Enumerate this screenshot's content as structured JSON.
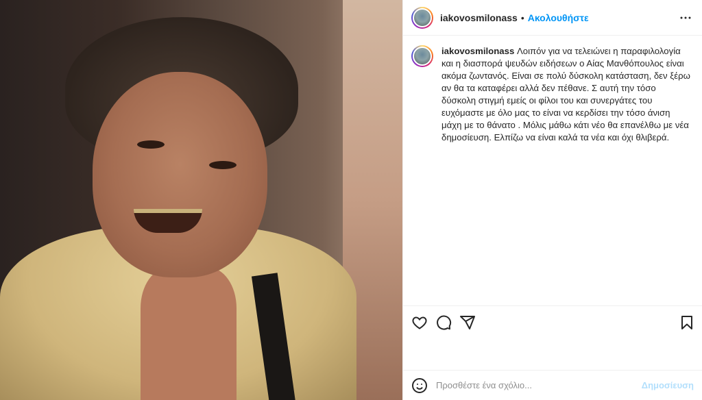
{
  "post": {
    "image": {
      "alt_icon": "photo"
    },
    "header": {
      "username": "iakovosmilonass",
      "separator": "•",
      "follow_label": "Ακολουθήστε",
      "more_icon": "more-horizontal-icon"
    },
    "caption": {
      "username": "iakovosmilonass",
      "text": "Λοιπόν για να τελειώνει η παραφιλολογία και η διασπορά ψευδών ειδήσεων ο Αίας Μανθόπουλος είναι ακόμα ζωντανός. Είναι σε πολύ δύσκολη κατάσταση, δεν ξέρω αν θα τα καταφέρει αλλά δεν πέθανε. Σ αυτή την τόσο δύσκολη στιγμή εμείς οι φίλοι του και συνεργάτες του ευχόμαστε με όλο μας το είναι να κερδίσει την τόσο άνιση μάχη με το θάνατο . Μόλις μάθω κάτι νέο θα επανέλθω με νέα δημοσίευση. Ελπίζω να είναι καλά τα νέα και όχι θλιβερά."
    },
    "actions": {
      "like_icon": "heart-icon",
      "comment_icon": "comment-icon",
      "share_icon": "send-icon",
      "save_icon": "bookmark-icon"
    },
    "add_comment": {
      "emoji_icon": "emoji-icon",
      "placeholder": "Προσθέστε ένα σχόλιο...",
      "post_label": "Δημοσίευση"
    }
  },
  "colors": {
    "accent": "#0095f6",
    "post_disabled": "#b2dffc",
    "text": "#262626",
    "muted": "#8e8e8e",
    "border": "#efefef"
  }
}
